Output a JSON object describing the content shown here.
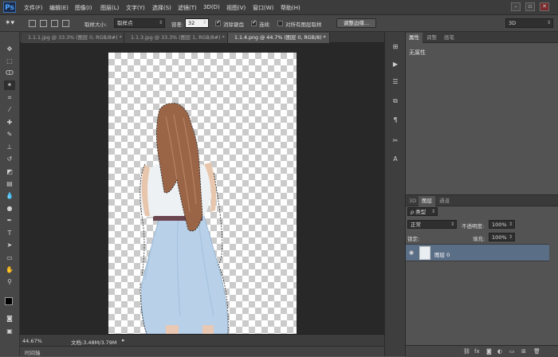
{
  "app": {
    "logo": "Ps"
  },
  "menu": [
    "文件(F)",
    "编辑(E)",
    "图像(I)",
    "图层(L)",
    "文字(Y)",
    "选择(S)",
    "滤镜(T)",
    "3D(D)",
    "视图(V)",
    "窗口(W)",
    "帮助(H)"
  ],
  "options": {
    "feather_label": "取样大小:",
    "sample_value": "取样点",
    "tolerance_label": "容差:",
    "tolerance_value": "32",
    "antialias_label": "消除锯齿",
    "contiguous_label": "连续",
    "all_layers_label": "对所有图层取样",
    "refine_button": "调整边缘...",
    "workspace": "3D"
  },
  "tabs": [
    "1.1.1.jpg @ 33.3% (图层 0, RGB/8#) *",
    "1.1.3.jpg @ 33.3% (图层 1, RGB/8#) *",
    "1.1.4.png @ 44.7% (图层 0, RGB/8) *"
  ],
  "status": {
    "zoom": "44.67%",
    "doc_info": "文档:3.48M/3.79M"
  },
  "timeline": "时间轴",
  "properties": {
    "tabs": [
      "属性",
      "调整",
      "画笔"
    ],
    "content": "无属性"
  },
  "layers": {
    "tabs": [
      "3D",
      "图层",
      "通道"
    ],
    "filter": "ρ 类型",
    "blend": "正常",
    "opacity_label": "不透明度:",
    "opacity": "100%",
    "lock_label": "锁定:",
    "fill_label": "填充:",
    "fill": "100%",
    "layer_name": "图层 0"
  }
}
